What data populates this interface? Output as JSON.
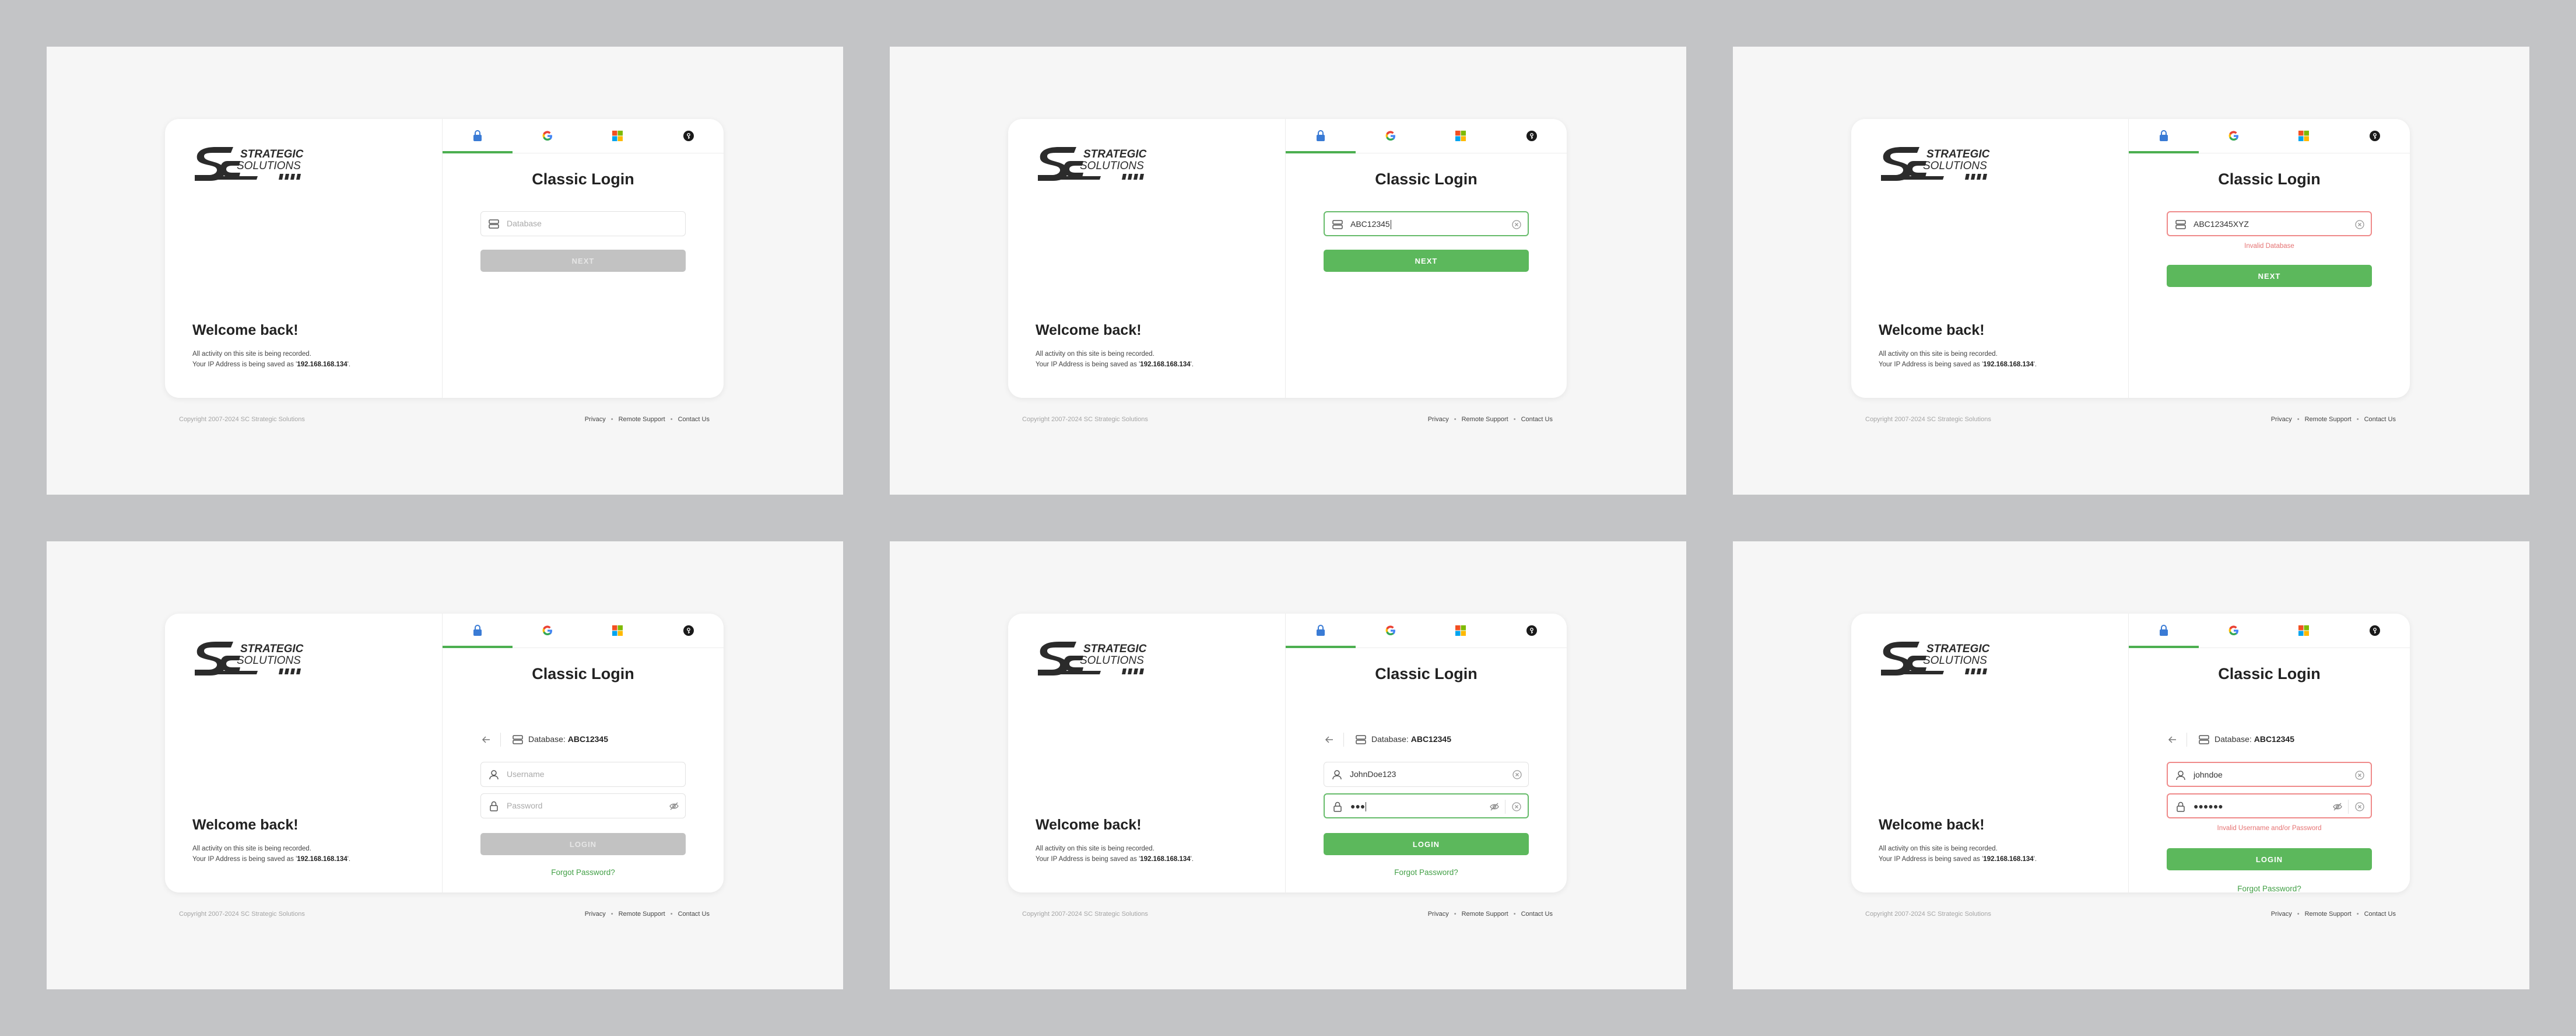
{
  "brand": {
    "line1": "STRATEGIC",
    "line2": "SOLUTIONS",
    "colors": {
      "primary": "#5cb85c",
      "error": "#e57373",
      "disabled": "#c2c2c2"
    }
  },
  "welcome": {
    "heading": "Welcome back!",
    "notice_line1": "All activity on this site is being recorded.",
    "notice_line2_prefix": "Your IP Address is being saved as '",
    "ip": "192.168.168.134",
    "notice_line2_suffix": "'."
  },
  "tabs": [
    {
      "icon": "lock-icon"
    },
    {
      "icon": "google-icon"
    },
    {
      "icon": "microsoft-icon"
    },
    {
      "icon": "sso-key-icon"
    }
  ],
  "login": {
    "title": "Classic Login",
    "database_placeholder": "Database",
    "username_placeholder": "Username",
    "password_placeholder": "Password",
    "next_label": "NEXT",
    "login_label": "LOGIN",
    "forgot_label": "Forgot Password?",
    "database_prefix": "Database: ",
    "database_selected": "ABC12345"
  },
  "screens": {
    "s2": {
      "database_value": "ABC12345"
    },
    "s3": {
      "database_value": "ABC12345XYZ",
      "error": "Invalid Database"
    },
    "s5": {
      "username_value": "JohnDoe123",
      "password_mask": "●●●"
    },
    "s6": {
      "username_value": "johndoe",
      "password_mask": "●●●●●●",
      "error": "Invalid Username and/or Password"
    }
  },
  "footer": {
    "copyright": "Copyright 2007-2024 SC Strategic Solutions",
    "links": [
      "Privacy",
      "Remote Support",
      "Contact Us"
    ]
  }
}
